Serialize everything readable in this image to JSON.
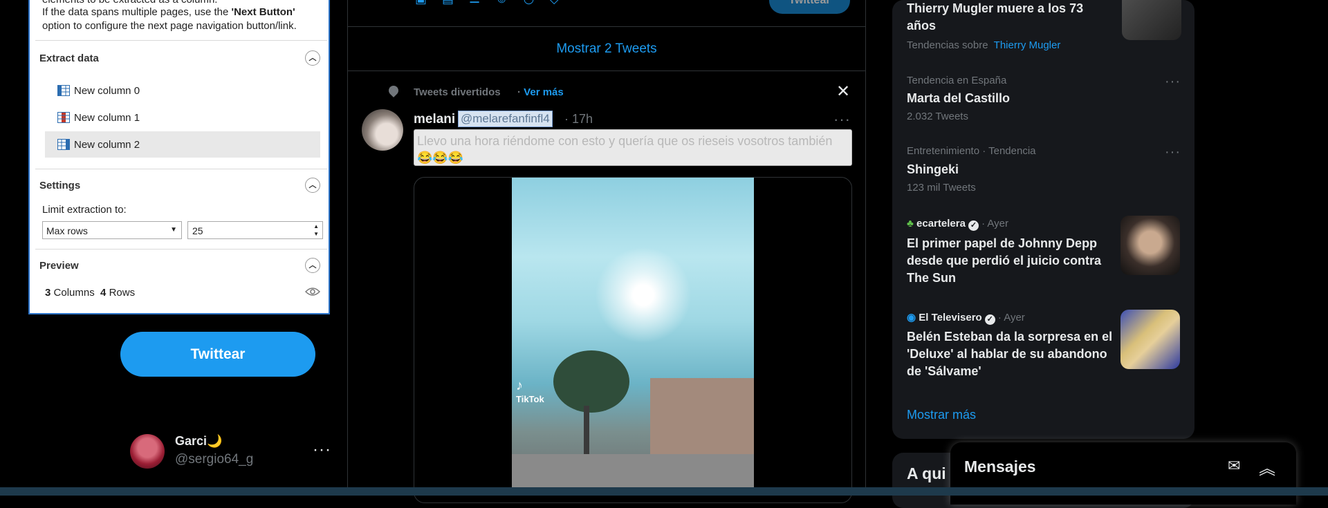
{
  "extract_panel": {
    "intro_line1": "elements to be extracted as a column.",
    "intro_line2_a": "If the data spans multiple pages, use the ",
    "intro_line2_b": "'Next Button'",
    "intro_line3": "option to configure the next page navigation button/link.",
    "extract_title": "Extract data",
    "columns": [
      "New column 0",
      "New column 1",
      "New column 2"
    ],
    "settings_title": "Settings",
    "limit_label": "Limit extraction to:",
    "limit_mode": "Max rows",
    "limit_value": "25",
    "preview_title": "Preview",
    "preview_columns": "3",
    "preview_columns_label": "Columns",
    "preview_rows": "4",
    "preview_rows_label": "Rows"
  },
  "nav": {
    "tweet_button": "Twittear",
    "user_name": "Garci🌙",
    "user_handle": "@sergio64_g",
    "more": "···"
  },
  "timeline": {
    "compose_button": "Twittear",
    "show_new": "Mostrar 2 Tweets",
    "topic_label": "Tweets divertidos",
    "topic_more": "Ver más",
    "tweet": {
      "name": "melani",
      "handle": "@melarefanfinfl4",
      "time": "· 17h",
      "text": "Llevo una hora riéndome con esto y quería que os rieseis vosotros también 😂😂😂",
      "video_watermark": "TikTok"
    }
  },
  "trends": [
    {
      "meta": "",
      "title": "Thierry Mugler muere a los 73 años",
      "sub_prefix": "Tendencias sobre",
      "sub_link": "Thierry Mugler"
    },
    {
      "meta": "Tendencia en España",
      "title": "Marta del Castillo",
      "sub": "2.032 Tweets"
    },
    {
      "meta": "Entretenimiento · Tendencia",
      "title": "Shingeki",
      "sub": "123 mil Tweets"
    },
    {
      "source": "ecartelera",
      "time": "· Ayer",
      "title": "El primer papel de Johnny Depp desde que perdió el juicio contra The Sun"
    },
    {
      "source": "El Televisero",
      "time": "· Ayer",
      "title": "Belén Esteban da la sorpresa en el 'Deluxe' al hablar de su abandono de 'Sálvame'"
    }
  ],
  "trends_show_more": "Mostrar más",
  "whois_title": "A qui",
  "messages": {
    "title": "Mensajes"
  },
  "colors": {
    "accent": "#1d9bf0",
    "panel_border": "#2b73c9",
    "trend_bg": "#16181c"
  }
}
